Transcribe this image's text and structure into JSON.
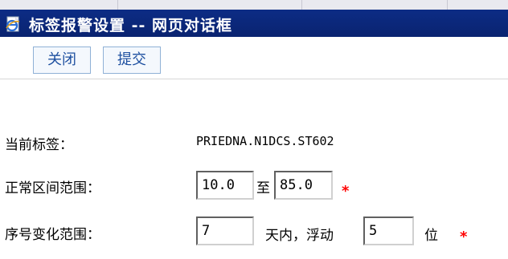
{
  "window": {
    "title": "标签报警设置 -- 网页对话框"
  },
  "toolbar": {
    "close_label": "关闭",
    "submit_label": "提交"
  },
  "form": {
    "current_tag_label": "当前标签：",
    "current_tag_value": "PRIEDNA.N1DCS.ST602",
    "normal_range_label": "正常区间范围：",
    "normal_range_min": "10.0",
    "normal_range_to": "至",
    "normal_range_max": "85.0",
    "seq_change_label": "序号变化范围：",
    "seq_days": "7",
    "seq_within_text": "天内，浮动",
    "seq_float": "5",
    "seq_unit": "位",
    "required_mark": "*"
  },
  "icons": {
    "title_icon": "ie-page-icon"
  },
  "colors": {
    "titlebar": "#0a2370",
    "required": "#ff0000",
    "button_text": "#1e50a0"
  }
}
